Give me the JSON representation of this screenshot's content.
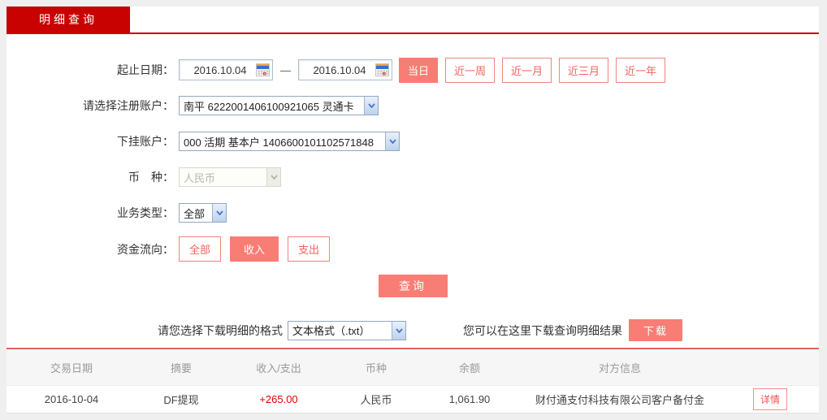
{
  "tab": {
    "label": "明细查询"
  },
  "form": {
    "date_row": {
      "label": "起止日期：",
      "from": "2016.10.04",
      "to": "2016.10.04",
      "separator": "—",
      "quick_buttons": [
        {
          "label": "当日",
          "active": true
        },
        {
          "label": "近一周",
          "active": false
        },
        {
          "label": "近一月",
          "active": false
        },
        {
          "label": "近三月",
          "active": false
        },
        {
          "label": "近一年",
          "active": false
        }
      ]
    },
    "register_account": {
      "label": "请选择注册账户：",
      "value": "南平 6222001406100921065 灵通卡"
    },
    "sub_account": {
      "label": "下挂账户：",
      "value": "000 活期 基本户 1406600101102571848"
    },
    "currency": {
      "label": "币　种：",
      "value": "人民币",
      "disabled": true
    },
    "business_type": {
      "label": "业务类型：",
      "value": "全部"
    },
    "fund_flow": {
      "label": "资金流向：",
      "options": [
        {
          "label": "全部",
          "active": false
        },
        {
          "label": "收入",
          "active": true
        },
        {
          "label": "支出",
          "active": false
        }
      ]
    },
    "query_button": "查询"
  },
  "download": {
    "format_label": "请您选择下载明细的格式",
    "format_value": "文本格式（.txt）",
    "hint": "您可以在这里下载查询明细结果",
    "button": "下载"
  },
  "table": {
    "headers": [
      "交易日期",
      "摘要",
      "收入/支出",
      "币种",
      "余额",
      "对方信息"
    ],
    "rows": [
      {
        "date": "2016-10-04",
        "summary": "DF提现",
        "amount": "+265.00",
        "currency": "人民币",
        "balance": "1,061.90",
        "counterparty": "财付通支付科技有限公司客户备付金",
        "detail_button": "详情"
      }
    ]
  },
  "colors": {
    "accent_red": "#c80101",
    "salmon": "#f87d74",
    "amount_red": "#e60000"
  }
}
